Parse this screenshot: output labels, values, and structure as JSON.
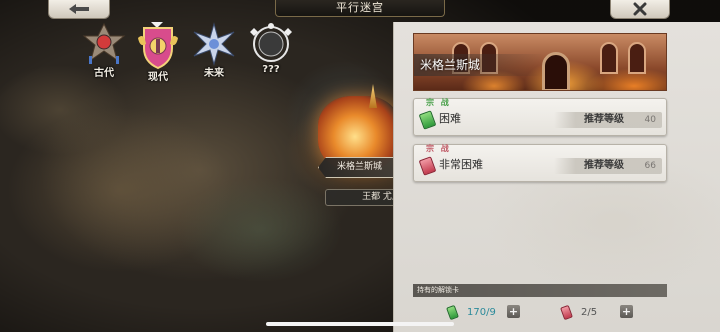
{
  "header": {
    "title": "平行迷宫",
    "back_icon": "arrow-left-icon",
    "close_icon": "close-x-icon"
  },
  "eras": [
    {
      "label": "古代",
      "icon": "ancient-crest-icon",
      "selected": false
    },
    {
      "label": "现代",
      "icon": "modern-crest-icon",
      "selected": true
    },
    {
      "label": "未来",
      "icon": "future-crest-icon",
      "selected": false
    },
    {
      "label": "???",
      "icon": "unknown-crest-icon",
      "selected": false
    }
  ],
  "map": {
    "selected_city": "米格兰斯城",
    "secondary_label": "王都 尤尼阿"
  },
  "panel": {
    "city_name": "米格兰斯城",
    "difficulties": [
      {
        "mode_tag": "宗 战",
        "name": "困难",
        "recommend_label": "推荐等级",
        "level": "40",
        "key_color": "#3fa64a"
      },
      {
        "mode_tag": "宗 战",
        "name": "非常困难",
        "recommend_label": "推荐等级",
        "level": "66",
        "key_color": "#d0485a"
      }
    ],
    "keys_label": "持有的解锁卡",
    "keys": [
      {
        "count": "170/9",
        "color": "green"
      },
      {
        "count": "2/5",
        "color": "red"
      }
    ]
  }
}
